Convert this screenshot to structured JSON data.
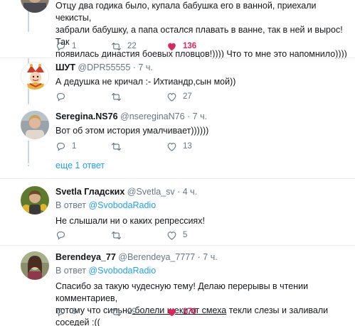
{
  "tweets": [
    {
      "text_lines": [
        "Отцу два годика было, купала бабушка его в ванной, приехали чекисты,",
        "забрали бабушку, а папа остался плавать в ванне, так в ней и вырос! Так",
        "появилась династия боевых пловцов!)))) Что то мне это напомнило))))"
      ],
      "replies": "1",
      "retweets": "22",
      "likes": "136",
      "liked": true
    },
    {
      "name": "ШУТ",
      "handle": "@DPR55555 · 7 ч.",
      "text": "А дедушка не кричал :- Ихтиандр,сын мой))",
      "replies": "",
      "retweets": "",
      "likes": "27"
    },
    {
      "name": "Seregina.NS76",
      "handle": "@nsereginaN76 · 7 ч.",
      "text": "Вот об этом история умалчивает))))))",
      "replies": "1",
      "retweets": "",
      "likes": "13"
    },
    {
      "name": "Svetla Гладских",
      "handle": "@Svetla_sv · 4 ч.",
      "reply_prefix": "В ответ",
      "reply_target": "@SvobodaRadio",
      "text": "Не слышали ни о каких репрессиях!",
      "replies": "",
      "retweets": "",
      "likes": "5"
    },
    {
      "name": "Berendeya_77",
      "handle": "@Berendeya_7777 · 7 ч.",
      "reply_prefix": "В ответ",
      "reply_target": "@SvobodaRadio",
      "text_line1": "Спасибо за такую чудесную тему! Делаю перерывы в чтении комментариев,",
      "text_line2_a": "потому что сильно",
      "text_line2_b": " болели щеки от смеха",
      "text_line2_c": " текли слезы и заливали соседей :((",
      "replies": "6",
      "retweets": "29",
      "likes": "170",
      "liked": true
    }
  ],
  "more_replies": "еще 1 ответ",
  "colors": {
    "accent": "#1da1f2",
    "like": "#e0245e",
    "muted": "#657786"
  },
  "icons": [
    "reply-icon",
    "retweet-icon",
    "like-icon",
    "heart-filled-icon"
  ]
}
